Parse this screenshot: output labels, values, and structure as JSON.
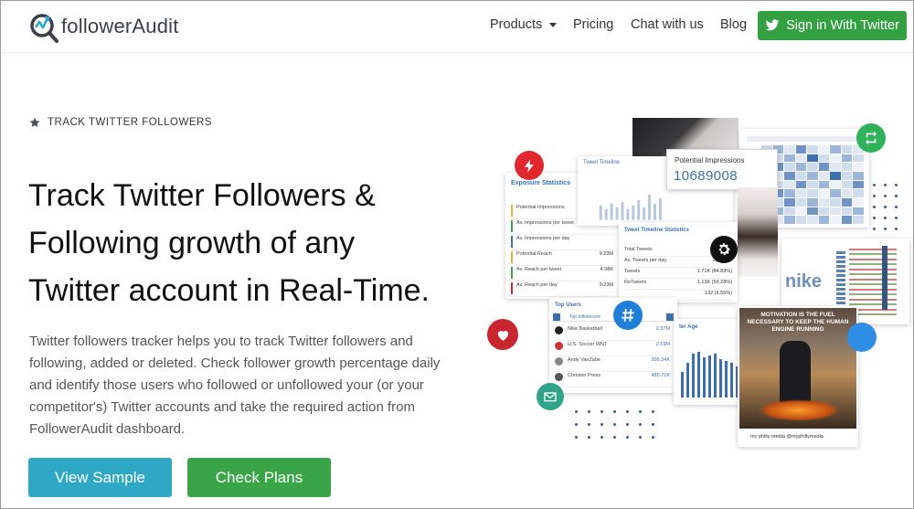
{
  "header": {
    "logo_text": "followerAudit",
    "nav": {
      "products": "Products",
      "pricing": "Pricing",
      "chat": "Chat with us",
      "blog": "Blog"
    },
    "signin_label": "Sign in With Twitter"
  },
  "hero": {
    "eyebrow": "TRACK TWITTER FOLLOWERS",
    "headline_line1": "Track Twitter Followers &",
    "headline_line2": "Following growth of any",
    "headline_line3": "Twitter account in Real-Time.",
    "description": "Twitter followers tracker helps you to track Twitter followers and following, added or deleted. Check follower growth percentage daily and identify those users who followed or unfollowed your (or your competitor's) Twitter accounts and take the required action from FollowerAudit dashboard.",
    "view_sample": "View Sample",
    "check_plans": "Check Plans"
  },
  "collage": {
    "potential_impressions_label": "Potential Impressions",
    "potential_impressions_value": "10689008",
    "exposure_title": "Exposure Statistics",
    "exposure_rows": [
      {
        "label": "Potential Impressions",
        "value": ""
      },
      {
        "label": "Av. Impressions per tweet",
        "value": ""
      },
      {
        "label": "Av. Impressions per day",
        "value": ""
      },
      {
        "label": "Potential Reach",
        "value": "9.23M"
      },
      {
        "label": "Av. Reach per tweet",
        "value": "4.58K"
      },
      {
        "label": "Av. Reach per day",
        "value": "9.23M"
      }
    ],
    "tweet_timeline_title": "Tweet Timeline",
    "tweet_stats_title": "Tweet Timeline Statistics",
    "tweet_stats_rows": [
      {
        "label": "Total Tweets",
        "value": "20"
      },
      {
        "label": "Av. Tweets per day",
        "value": "2,015.00"
      },
      {
        "label": "Tweets",
        "value": "1.71K (84.89%)"
      },
      {
        "label": "ReTweets",
        "value": "1.13K (56.28%)"
      },
      {
        "label": "",
        "value": "132 (6.55%)"
      }
    ],
    "top_users_title": "Top Users",
    "top_users_tab": "Top Influencers",
    "top_users": [
      {
        "name": "Nike Basketball",
        "value": "2.37M"
      },
      {
        "name": "U.S. Soccer WNT",
        "value": "2.19M"
      },
      {
        "name": "Andy VanZabe",
        "value": "306.34K"
      },
      {
        "name": "Christen Press",
        "value": "485.71K"
      }
    ],
    "follower_age_title": "ter Age",
    "motivation_text": "MOTIVATION IS THE FUEL NECESSARY TO KEEP THE HUMAN ENGINE RUNNING",
    "motivation_caption": "my philly media @myphillymedia",
    "nike_word": "nike",
    "colors": {
      "twitter_blue": "#1da1f2",
      "chart_blue": "#3b6fae",
      "green": "#33a142",
      "red": "#d7282f",
      "teal": "#2fa489"
    }
  }
}
